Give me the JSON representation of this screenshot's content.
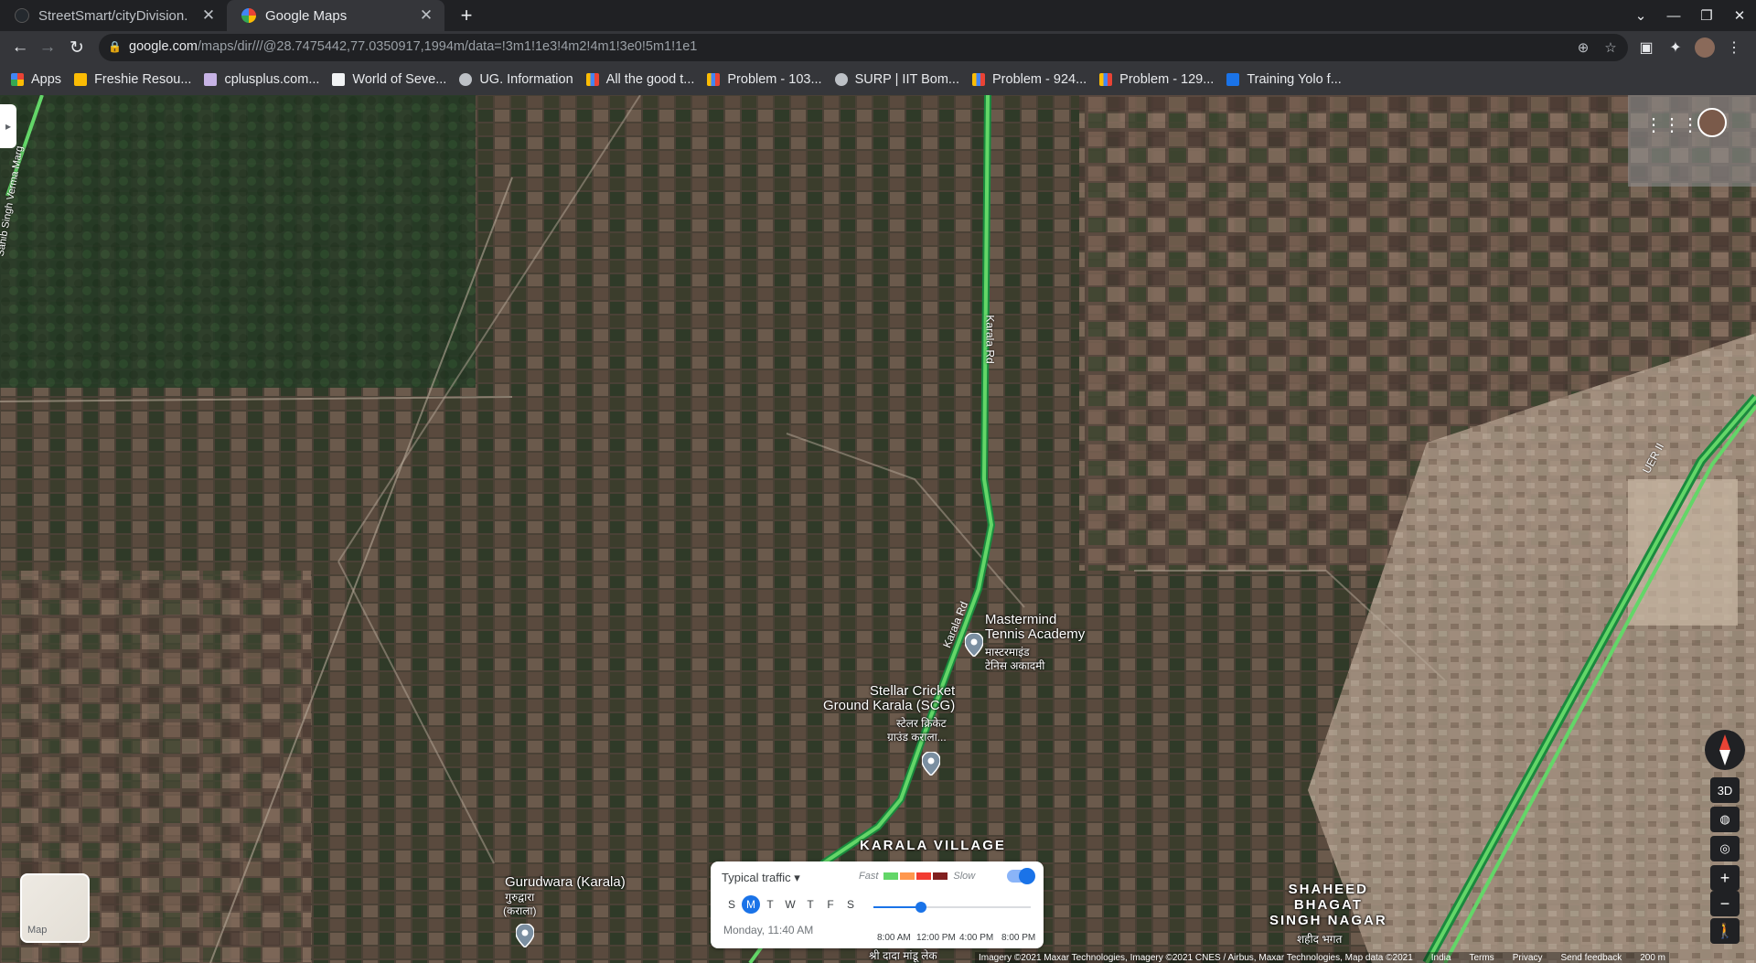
{
  "browser": {
    "tabs": [
      {
        "title": "StreetSmart/cityDivision.",
        "active": false
      },
      {
        "title": "Google Maps",
        "active": true
      }
    ],
    "url_host": "google.com",
    "url_path": "/maps/dir///@28.7475442,77.0350917,1994m/data=!3m1!1e3!4m2!4m1!3e0!5m1!1e1",
    "bookmarks": [
      "Apps",
      "Freshie Resou...",
      "cplusplus.com...",
      "World of Seve...",
      "UG. Information",
      "All the good t...",
      "Problem - 103...",
      "SURP | IIT Bom...",
      "Problem - 924...",
      "Problem - 129...",
      "Training Yolo f..."
    ]
  },
  "map": {
    "places": {
      "mastermind_name": "Mastermind\nTennis Academy",
      "mastermind_local": "मास्टरमाइंड\nटेनिस अकादमी",
      "stellar_name": "Stellar Cricket\nGround Karala (SCG)",
      "stellar_local": "स्टेलर क्रिकेट\nग्राउंड कराला...",
      "gurudwara_name": "Gurudwara (Karala)",
      "gurudwara_local": "गुरुद्वारा\n(कराला)",
      "karala_village": "KARALA VILLAGE",
      "shaheed": "SHAHEED\nBHAGAT\nSINGH NAGAR",
      "shaheed_local": "शहीद भगत",
      "bottom_local": "श्री दादा मांडू लेक"
    },
    "roads": {
      "karala_rd_north": "Karala Rd",
      "karala_rd_south": "Karala Rd",
      "uer": "UER II",
      "left_marg": "Sahib Singh Verma Marg"
    },
    "layer_label": "Map",
    "controls": {
      "three_d": "3D"
    },
    "traffic": {
      "mode": "Typical traffic",
      "fast": "Fast",
      "slow": "Slow",
      "days": [
        "S",
        "M",
        "T",
        "W",
        "T",
        "F",
        "S"
      ],
      "selected_day_index": 1,
      "when": "Monday, 11:40 AM",
      "ticks": [
        "8:00 AM",
        "12:00 PM",
        "4:00 PM",
        "8:00 PM"
      ],
      "slider_fraction": 0.3,
      "colors": [
        "#63d668",
        "#ff974d",
        "#f23c32",
        "#811f1f"
      ]
    },
    "footer": {
      "imagery": "Imagery ©2021 Maxar Technologies, Imagery ©2021 CNES / Airbus, Maxar Technologies, Map data ©2021",
      "india": "India",
      "terms": "Terms",
      "privacy": "Privacy",
      "feedback": "Send feedback",
      "scale": "200 m"
    }
  }
}
